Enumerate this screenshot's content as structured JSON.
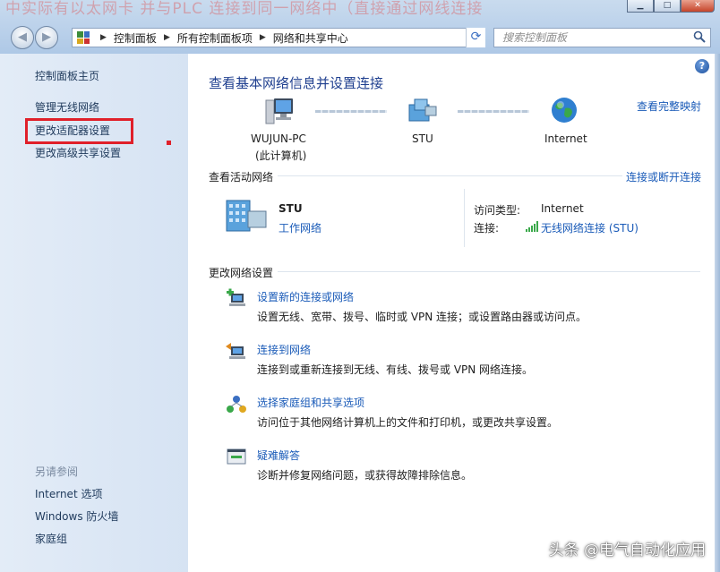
{
  "window": {
    "background_text": "中实际有以太网卡 并与PLC 连接到同一网络中（直接通过网线连接",
    "min_label": "▁",
    "max_label": "□",
    "close_label": "✕"
  },
  "address_bar": {
    "crumbs": [
      "控制面板",
      "所有控制面板项",
      "网络和共享中心"
    ],
    "search_placeholder": "搜索控制面板"
  },
  "sidebar": {
    "items": [
      {
        "label": "控制面板主页"
      },
      {
        "label": "管理无线网络"
      },
      {
        "label": "更改适配器设置"
      },
      {
        "label": "更改高级共享设置"
      }
    ],
    "see_also_heading": "另请参阅",
    "see_also": [
      {
        "label": "Internet 选项"
      },
      {
        "label": "Windows 防火墙"
      },
      {
        "label": "家庭组"
      }
    ]
  },
  "main": {
    "title": "查看基本网络信息并设置连接",
    "view_full_map": "查看完整映射",
    "nodes": [
      {
        "label": "WUJUN-PC",
        "sublabel": "(此计算机)",
        "icon": "computer-icon"
      },
      {
        "label": "STU",
        "icon": "network-icon"
      },
      {
        "label": "Internet",
        "icon": "globe-icon"
      }
    ],
    "active_section": {
      "heading": "查看活动网络",
      "connect_link": "连接或断开连接",
      "network_name": "STU",
      "network_type": "工作网络",
      "access_type_label": "访问类型:",
      "access_type_value": "Internet",
      "connection_label": "连接:",
      "connection_value": "无线网络连接 (STU)"
    },
    "change_section": {
      "heading": "更改网络设置",
      "tasks": [
        {
          "link": "设置新的连接或网络",
          "desc": "设置无线、宽带、拨号、临时或 VPN 连接；或设置路由器或访问点。",
          "icon": "new-connection-icon"
        },
        {
          "link": "连接到网络",
          "desc": "连接到或重新连接到无线、有线、拨号或 VPN 网络连接。",
          "icon": "connect-network-icon"
        },
        {
          "link": "选择家庭组和共享选项",
          "desc": "访问位于其他网络计算机上的文件和打印机，或更改共享设置。",
          "icon": "homegroup-icon"
        },
        {
          "link": "疑难解答",
          "desc": "诊断并修复网络问题，或获得故障排除信息。",
          "icon": "troubleshoot-icon"
        }
      ]
    }
  },
  "watermark": "头条 @电气自动化应用",
  "colors": {
    "link": "#1a5bb8",
    "title": "#1f3f8f",
    "sidebar_bg": "#dce7f4",
    "highlight": "#e0202a"
  }
}
